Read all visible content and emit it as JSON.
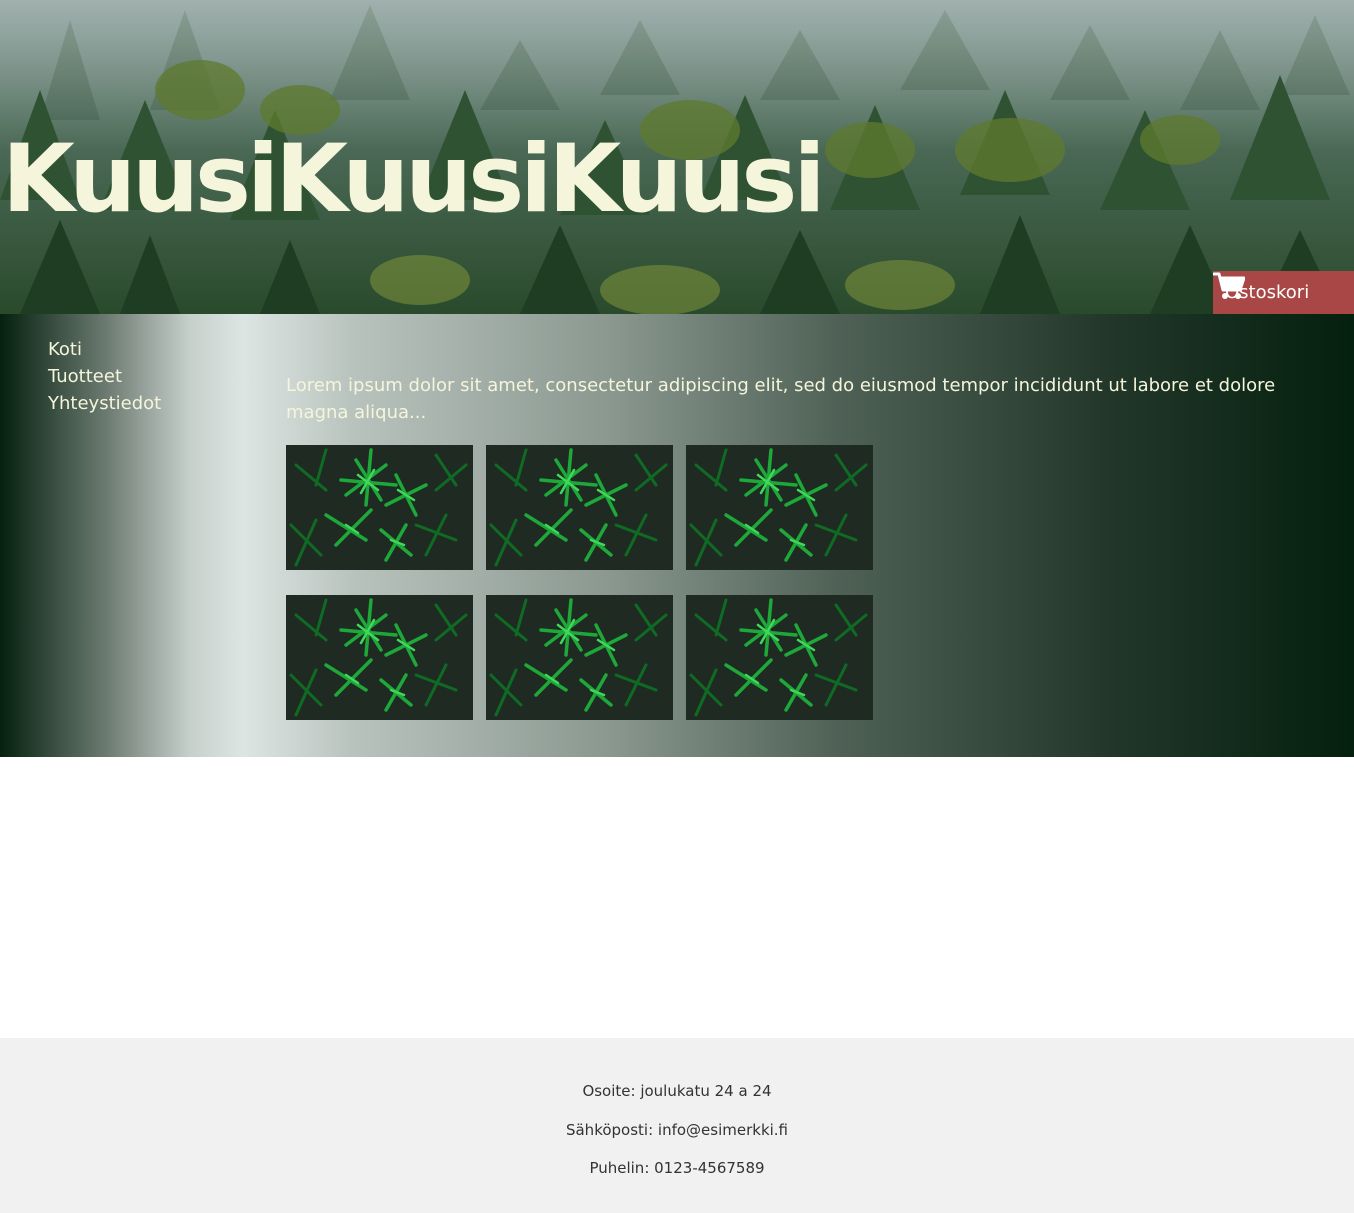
{
  "header": {
    "title": "KuusiKuusiKuusi",
    "cart_label": "Ostoskori",
    "cart_icon": "shopping-cart-icon",
    "title_color": "#f5f5dc",
    "cart_color": "#a94747"
  },
  "nav": {
    "items": [
      {
        "label": "Koti"
      },
      {
        "label": "Tuotteet"
      },
      {
        "label": "Yhteystiedot"
      }
    ]
  },
  "main": {
    "intro": "Lorem ipsum dolor sit amet, consectetur adipiscing elit, sed do eiusmod tempor incididunt ut labore et dolore magna aliqua...",
    "gallery_image": "spruce-branch-photo"
  },
  "footer": {
    "address": "Osoite: joulukatu 24 a 24",
    "email": "Sähköposti: info@esimerkki.fi",
    "phone": "Puhelin: 0123-4567589"
  }
}
